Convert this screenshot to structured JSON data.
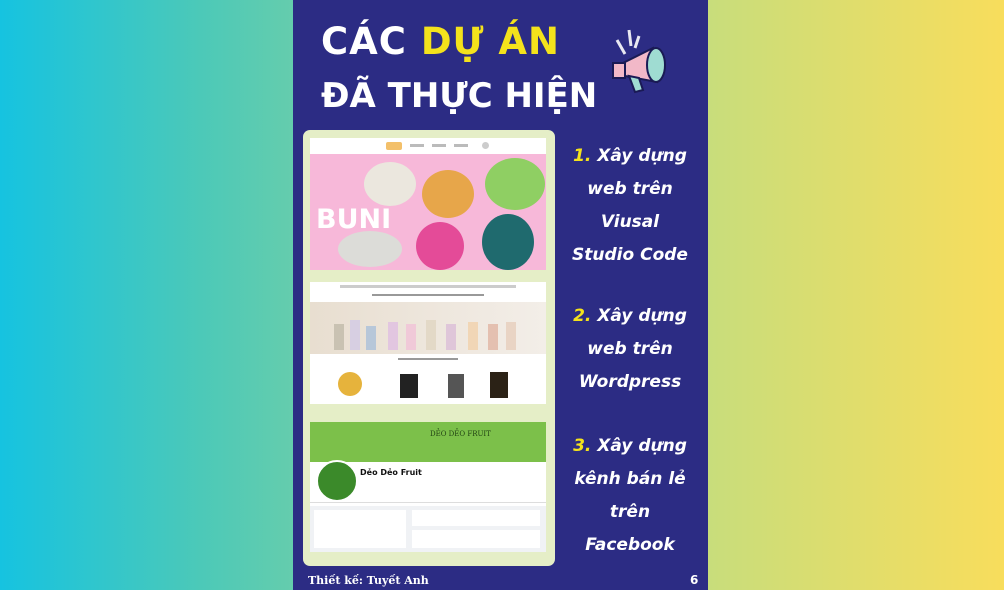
{
  "poster": {
    "title_line1_prefix": "CÁC",
    "title_line1_highlight": "DỰ ÁN",
    "title_line2": "ĐÃ THỰC HIỆN",
    "icon": "megaphone-icon",
    "items": [
      {
        "number": "1.",
        "lines": [
          "Xây dựng",
          "web trên",
          "Viusal",
          "Studio Code"
        ]
      },
      {
        "number": "2.",
        "lines": [
          "Xây dựng",
          "web trên",
          "Wordpress"
        ]
      },
      {
        "number": "3.",
        "lines": [
          "Xây dựng",
          "kênh bán lẻ",
          "trên",
          "Facebook"
        ]
      }
    ],
    "footer": "Thiết kế: Tuyết Anh",
    "page_number": "6"
  },
  "screens": {
    "buni_logo": "BUNI",
    "fb_banner": "DẺO DẺO FRUIT",
    "fb_page_name": "Dẻo Dẻo Fruit"
  },
  "colors": {
    "poster_bg": "#2c2c84",
    "accent_yellow": "#f4e21c",
    "frame_bg": "#e5eec7"
  }
}
